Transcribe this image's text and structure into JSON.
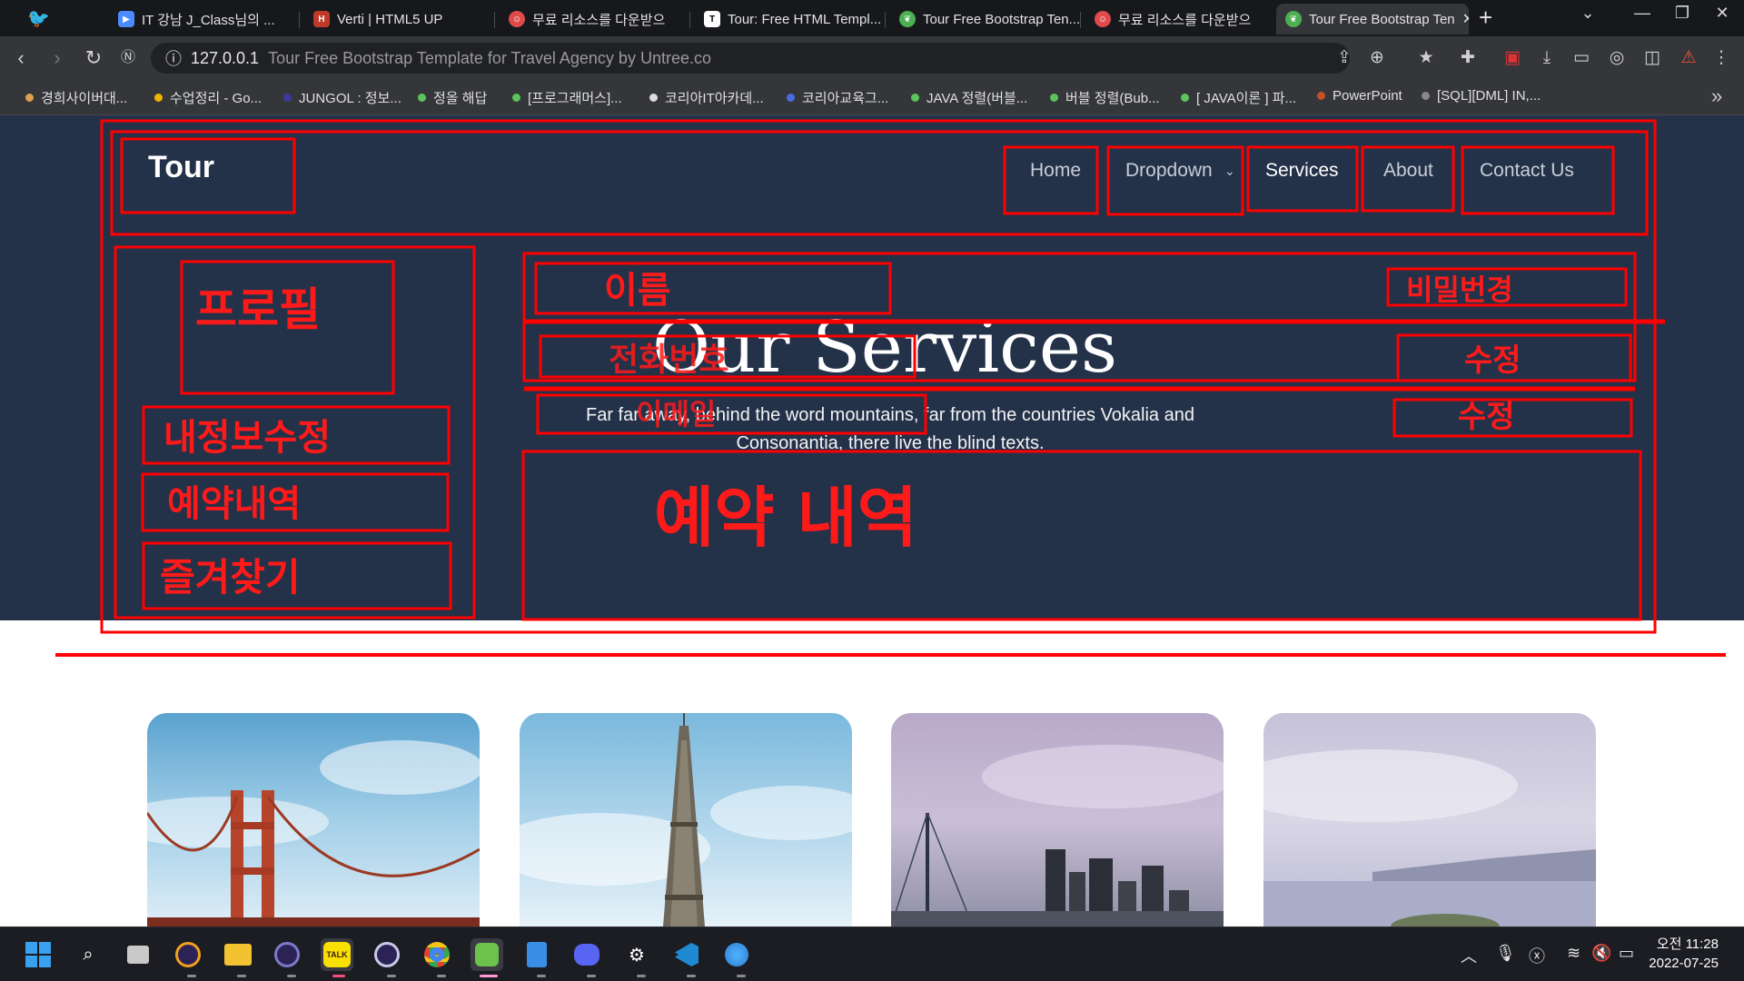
{
  "browser": {
    "tabs": [
      {
        "label": "IT 강남 J_Class님의 ...",
        "icon": "zoom-icon",
        "color": "#4a8cff"
      },
      {
        "label": "Verti | HTML5 UP",
        "icon": "hsu-icon",
        "color": "#c0392b"
      },
      {
        "label": "무료 리소스를 다운받으",
        "icon": "smile-icon",
        "color": "#e04a4a"
      },
      {
        "label": "Tour: Free HTML Templ...",
        "icon": "th-icon",
        "color": "#ffffff"
      },
      {
        "label": "Tour Free Bootstrap Ten...",
        "icon": "leaf-icon",
        "color": "#4caf50"
      },
      {
        "label": "무료 리소스를 다운받으",
        "icon": "smile-icon",
        "color": "#e04a4a"
      },
      {
        "label": "Tour Free Bootstrap Ten",
        "icon": "leaf-icon",
        "color": "#4caf50"
      }
    ],
    "new_tab": "+",
    "address": {
      "url": "127.0.0.1",
      "page_title": "Tour Free Bootstrap Template for Travel Agency by Untree.co"
    },
    "bookmarks": [
      {
        "label": "경희사이버대...",
        "color": "#e0a050"
      },
      {
        "label": "수업정리 - Go...",
        "color": "#f0b400"
      },
      {
        "label": "JUNGOL : 정보...",
        "color": "#3a3aa0"
      },
      {
        "label": "정올 해답",
        "color": "#5cc45c"
      },
      {
        "label": "[프로그래머스]...",
        "color": "#5cc45c"
      },
      {
        "label": "코리아IT아카데...",
        "color": "#dddddd"
      },
      {
        "label": "코리아교육그...",
        "color": "#4a6ae0"
      },
      {
        "label": "JAVA 정렬(버블...",
        "color": "#5cc45c"
      },
      {
        "label": "버블 정렬(Bub...",
        "color": "#5cc45c"
      },
      {
        "label": "[ JAVA이론 ] 파...",
        "color": "#5cc45c"
      },
      {
        "label": "PowerPoint",
        "color": "#c5502a"
      },
      {
        "label": "[SQL][DML] IN,...",
        "color": "#888888"
      }
    ],
    "more_bookmarks": "»"
  },
  "site": {
    "logo": "Tour",
    "nav": [
      "Home",
      "Dropdown",
      "Services",
      "About",
      "Contact Us"
    ],
    "hero_title": "Our Services",
    "hero_subtitle": "Far far away, behind the word mountains, far from the countries Vokalia and Consonantia, there live the blind texts."
  },
  "annotations": {
    "profile": "프로필",
    "edit_info": "내정보수정",
    "reservations_sidebar": "예약내역",
    "favorites": "즐겨찾기",
    "name": "이름",
    "phone": "전화번호",
    "email": "이메일",
    "change_password": "비밀번경",
    "edit_1": "수정",
    "edit_2": "수정",
    "reservation_history": "예약 내역"
  },
  "taskbar": {
    "apps": [
      "start-icon",
      "search-icon",
      "task-view-icon",
      "eclipse-icon",
      "file-explorer-icon",
      "eclipse-icon",
      "kakaotalk-icon",
      "eclipse-icon",
      "chrome-icon",
      "sts-icon",
      "notepad-icon",
      "discord-icon",
      "settings-icon",
      "vscode-icon",
      "maps-icon"
    ],
    "kakao_label": "TALK",
    "clock_time": "오전 11:28",
    "clock_date": "2022-07-25"
  }
}
